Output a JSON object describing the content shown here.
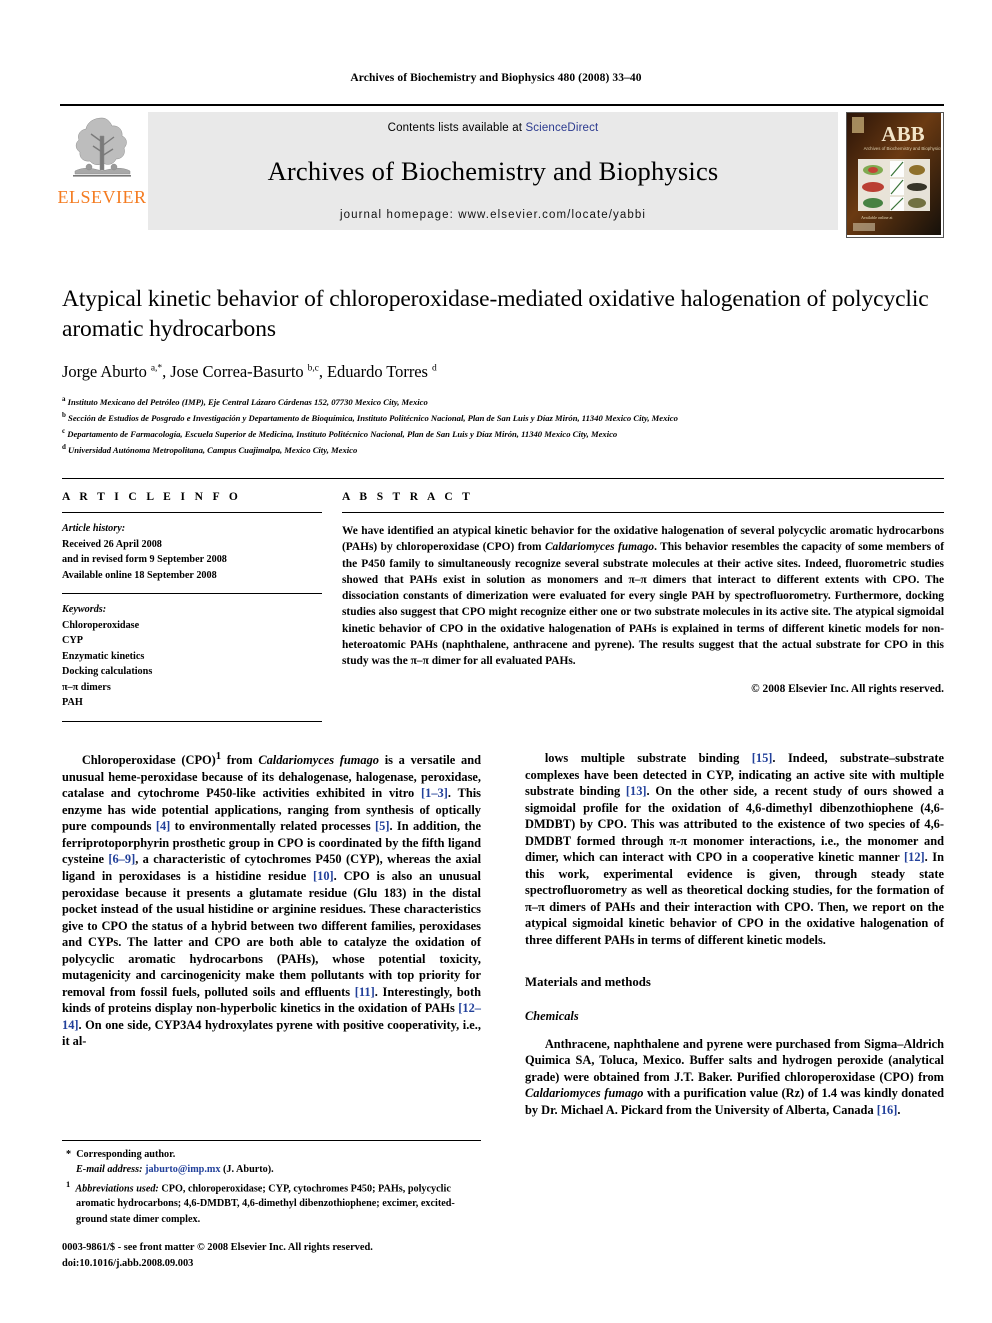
{
  "running_head": "Archives of Biochemistry and Biophysics 480 (2008) 33–40",
  "masthead": {
    "publisher": "ELSEVIER",
    "contents_prefix": "Contents lists available at ",
    "contents_link": "ScienceDirect",
    "journal_title": "Archives of Biochemistry and Biophysics",
    "homepage": "journal homepage: www.elsevier.com/locate/yabbi",
    "cover_title": "ABB",
    "cover_subtitle": "Archives of Biochemistry and Biophysics"
  },
  "article": {
    "title": "Atypical kinetic behavior of chloroperoxidase-mediated oxidative halogenation of polycyclic aromatic hydrocarbons",
    "authors_html": "Jorge Aburto <sup>a,*</sup>, Jose Correa-Basurto <sup>b,c</sup>, Eduardo Torres <sup>d</sup>",
    "affiliations": [
      "Instituto Mexicano del Petróleo (IMP), Eje Central Lázaro Cárdenas 152, 07730 Mexico City, Mexico",
      "Sección de Estudios de Posgrado e Investigación y Departamento de Bioquímica, Instituto Politécnico Nacional, Plan de San Luis y Díaz Mirón, 11340 Mexico City, Mexico",
      "Departamento de Farmacología, Escuela Superior de Medicina, Instituto Politécnico Nacional, Plan de San Luis y Díaz Mirón, 11340 Mexico City, Mexico",
      "Universidad Autónoma Metropolitana, Campus Cuajimalpa, Mexico City, Mexico"
    ],
    "affiliation_marks": [
      "a",
      "b",
      "c",
      "d"
    ]
  },
  "article_info": {
    "heading": "A R T I C L E  I N F O",
    "history_label": "Article history:",
    "history_lines": [
      "Received 26 April 2008",
      "and in revised form  9 September 2008",
      "Available online 18 September 2008"
    ],
    "keywords_label": "Keywords:",
    "keywords": [
      "Chloroperoxidase",
      "CYP",
      "Enzymatic kinetics",
      "Docking calculations",
      "π–π dimers",
      "PAH"
    ]
  },
  "abstract": {
    "heading": "A B S T R A C T",
    "text_html": "We have identified an atypical kinetic behavior for the oxidative halogenation of several polycyclic aromatic hydrocarbons (PAHs) by chloroperoxidase (CPO) from <span class=\"it\">Caldariomyces fumago</span>. This behavior resembles the capacity of some members of the P450 family to simultaneously recognize several substrate molecules at their active sites. Indeed, fluorometric studies showed that PAHs exist in solution as monomers and π–π dimers that interact to different extents with CPO. The dissociation constants of dimerization were evaluated for every single PAH by spectrofluorometry. Furthermore, docking studies also suggest that CPO might recognize either one or two substrate molecules in its active site. The atypical sigmoidal kinetic behavior of CPO in the oxidative halogenation of PAHs is explained in terms of different kinetic models for non-heteroatomic PAHs (naphthalene, anthracene and pyrene). The results suggest that the actual substrate for CPO in this study was the π–π dimer for all evaluated PAHs.",
    "copyright": "© 2008 Elsevier Inc. All rights reserved."
  },
  "body": {
    "left_col_html": [
      "Chloroperoxidase (CPO)<sup>1</sup> from <span class=\"it\">Caldariomyces fumago</span> is a versatile and unusual heme-peroxidase because of its dehalogenase, halogenase, peroxidase, catalase and cytochrome P450-like activities exhibited in vitro <span class=\"ref\">[1–3]</span>. This enzyme has wide potential applications, ranging from synthesis of optically pure compounds <span class=\"ref\">[4]</span> to environmentally related processes <span class=\"ref\">[5]</span>. In addition, the ferriprotoporphyrin prosthetic group in CPO is coordinated by the fifth ligand cysteine <span class=\"ref\">[6–9]</span>, a characteristic of cytochromes P450 (CYP), whereas the axial ligand in peroxidases is a histidine residue <span class=\"ref\">[10]</span>. CPO is also an unusual peroxidase because it presents a glutamate residue (Glu 183) in the distal pocket instead of the usual histidine or arginine residues. These characteristics give to CPO the status of a hybrid between two different families, peroxidases and CYPs. The latter and CPO are both able to catalyze the oxidation of polycyclic aromatic hydrocarbons (PAHs), whose potential toxicity, mutagenicity and carcinogenicity make them pollutants with top priority for removal from fossil fuels, polluted soils and effluents <span class=\"ref\">[11]</span>. Interestingly, both kinds of proteins display non-hyperbolic kinetics in the oxidation of PAHs <span class=\"ref\">[12–14]</span>. On one side, CYP3A4 hydroxylates pyrene with positive cooperativity, i.e., it al-"
    ],
    "right_col_html": [
      "lows multiple substrate binding <span class=\"ref\">[15]</span>. Indeed, substrate–substrate complexes have been detected in CYP, indicating an active site with multiple substrate binding <span class=\"ref\">[13]</span>. On the other side, a recent study of ours showed a sigmoidal profile for the oxidation of 4,6-dimethyl dibenzothiophene (4,6-DMDBT) by CPO. This was attributed to the existence of two species of 4,6-DMDBT formed through π-π monomer interactions, i.e., the monomer and dimer, which can interact with CPO in a cooperative kinetic manner <span class=\"ref\">[12]</span>. In this work, experimental evidence is given, through steady state spectrofluorometry as well as theoretical docking studies, for the formation of π–π dimers of PAHs and their interaction with CPO. Then, we report on the atypical sigmoidal kinetic behavior of CPO in the oxidative halogenation of three different PAHs in terms of different kinetic models."
    ],
    "section_heading": "Materials and methods",
    "subsection_heading": "Chemicals",
    "chemicals_html": "Anthracene, naphthalene and pyrene were purchased from Sigma–Aldrich Quimica SA, Toluca, Mexico. Buffer salts and hydrogen peroxide (analytical grade) were obtained from J.T. Baker. Purified chloroperoxidase (CPO) from <span class=\"it\">Caldariomyces fumago</span> with a purification value (Rz) of 1.4 was kindly donated by Dr. Michael A. Pickard from the University of Alberta, Canada <span class=\"ref\">[16]</span>."
  },
  "footnotes": {
    "corresponding_html": "* &nbsp;Corresponding author.",
    "email_html": "<span class=\"it\">E-mail address:</span> <span class=\"email\">jaburto@imp.mx</span> (J. Aburto).",
    "abbrev_html": "<sup>1</sup> &nbsp;<span class=\"it\">Abbreviations used:</span> CPO, chloroperoxidase; CYP, cytochromes P450; PAHs, polycyclic aromatic hydrocarbons; 4,6-DMDBT, 4,6-dimethyl dibenzothiophene; excimer, excited-ground state dimer complex."
  },
  "imprint": {
    "issn_line": "0003-9861/$ - see front matter © 2008 Elsevier Inc. All rights reserved.",
    "doi_line": "doi:10.1016/j.abb.2008.09.003"
  },
  "colors": {
    "elsevier_orange": "#f47b20",
    "link_blue": "#2b3a8f",
    "reference_blue": "#22409a",
    "band_gray": "#e9e9e9"
  }
}
